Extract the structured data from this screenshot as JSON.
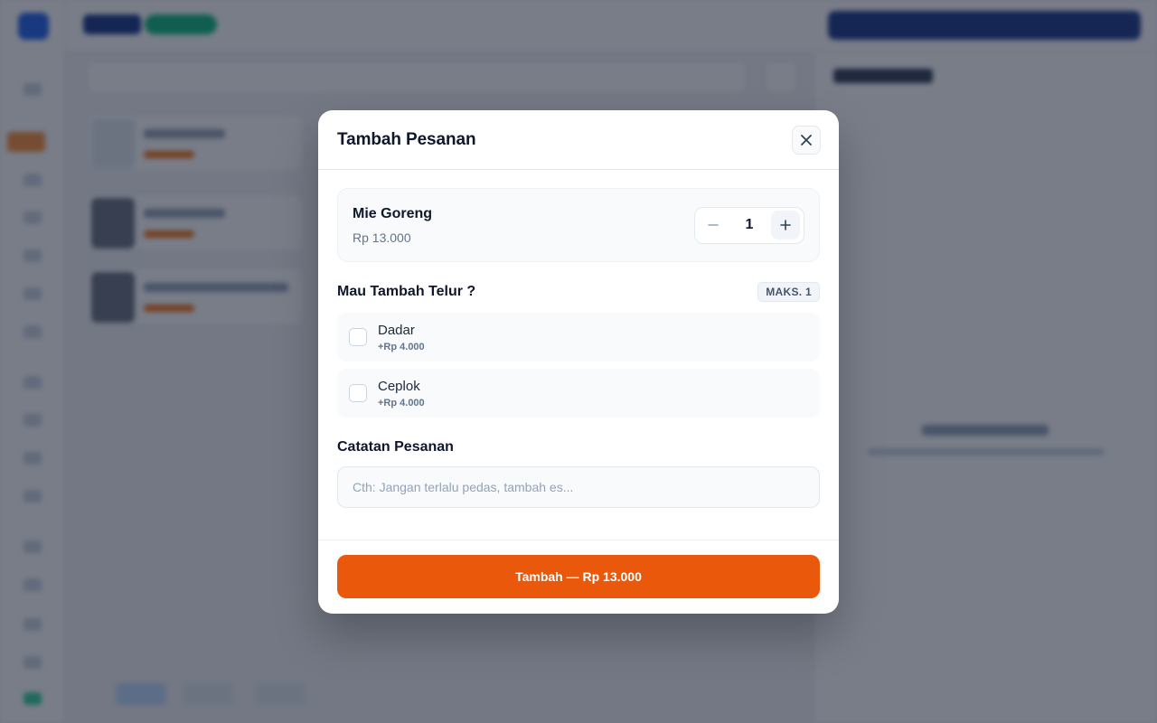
{
  "modal": {
    "title": "Tambah Pesanan",
    "close_icon": "close-icon"
  },
  "product": {
    "name": "Mie Goreng",
    "price": "Rp 13.000",
    "quantity": "1",
    "minus_icon": "minus-icon",
    "plus_icon": "plus-icon"
  },
  "addon_group": {
    "title": "Mau Tambah Telur ?",
    "max_badge": "MAKS. 1",
    "options": [
      {
        "name": "Dadar",
        "price": "+Rp 4.000",
        "checked": false
      },
      {
        "name": "Ceplok",
        "price": "+Rp 4.000",
        "checked": false
      }
    ]
  },
  "notes": {
    "title": "Catatan Pesanan",
    "placeholder": "Cth: Jangan terlalu pedas, tambah es...",
    "value": ""
  },
  "footer": {
    "submit_label": "Tambah — Rp 13.000"
  },
  "colors": {
    "accent": "#ea580c",
    "overlay": "#0f172a"
  }
}
